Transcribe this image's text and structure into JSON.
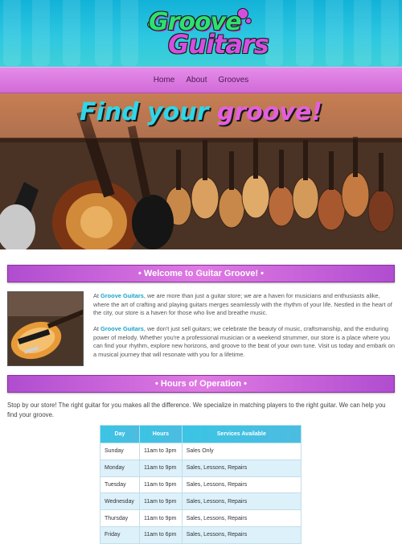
{
  "header": {
    "logo_line1": "Groove",
    "logo_line2": "Guitars",
    "colors": {
      "bg": "#1fbcdc",
      "logo_green": "#2ee070",
      "logo_pink": "#d44fe0"
    }
  },
  "nav": {
    "items": [
      {
        "label": "Home"
      },
      {
        "label": "About"
      },
      {
        "label": "Grooves"
      }
    ],
    "color": "#d977dd"
  },
  "hero": {
    "title_part1": "Find your ",
    "title_part2": "groove!",
    "icon": "guitar-wall-photo"
  },
  "welcome": {
    "heading": "• Welcome to Guitar Groove! •",
    "image_icon": "bass-guitar-photo",
    "p1": {
      "before": "At ",
      "brand": "Groove Guitars",
      "after": ", we are more than just a guitar store; we are a haven for musicians and enthusiasts alike, where the art of crafting and playing guitars merges seamlessly with the rhythm of your life. Nestled in the heart of the city, our store is a haven for those who live and breathe music."
    },
    "p2": {
      "before": "At ",
      "brand": "Groove Guitars",
      "after": ", we don't just sell guitars; we celebrate the beauty of music, craftsmanship, and the enduring power of melody. Whether you're a professional musician or a weekend strummer, our store is a place where you can find your rhythm, explore new horizons, and groove to the beat of your own tune. Visit us today and embark on a musical journey that will resonate with you for a lifetime."
    }
  },
  "hours": {
    "heading": "• Hours of Operation •",
    "intro": "Stop by our store! The right guitar for you makes all the difference. We specialize in matching players to the right guitar. We can help you find your groove.",
    "columns": [
      "Day",
      "Hours",
      "Services Available"
    ],
    "rows": [
      [
        "Sunday",
        "11am to 3pm",
        "Sales Only"
      ],
      [
        "Monday",
        "11am to 9pm",
        "Sales, Lessons, Repairs"
      ],
      [
        "Tuesday",
        "11am to 9pm",
        "Sales, Lessons, Repairs"
      ],
      [
        "Wednesday",
        "11am to 9pm",
        "Sales, Lessons, Repairs"
      ],
      [
        "Thursday",
        "11am to 9pm",
        "Sales, Lessons, Repairs"
      ],
      [
        "Friday",
        "11am to 6pm",
        "Sales, Lessons, Repairs"
      ]
    ]
  }
}
